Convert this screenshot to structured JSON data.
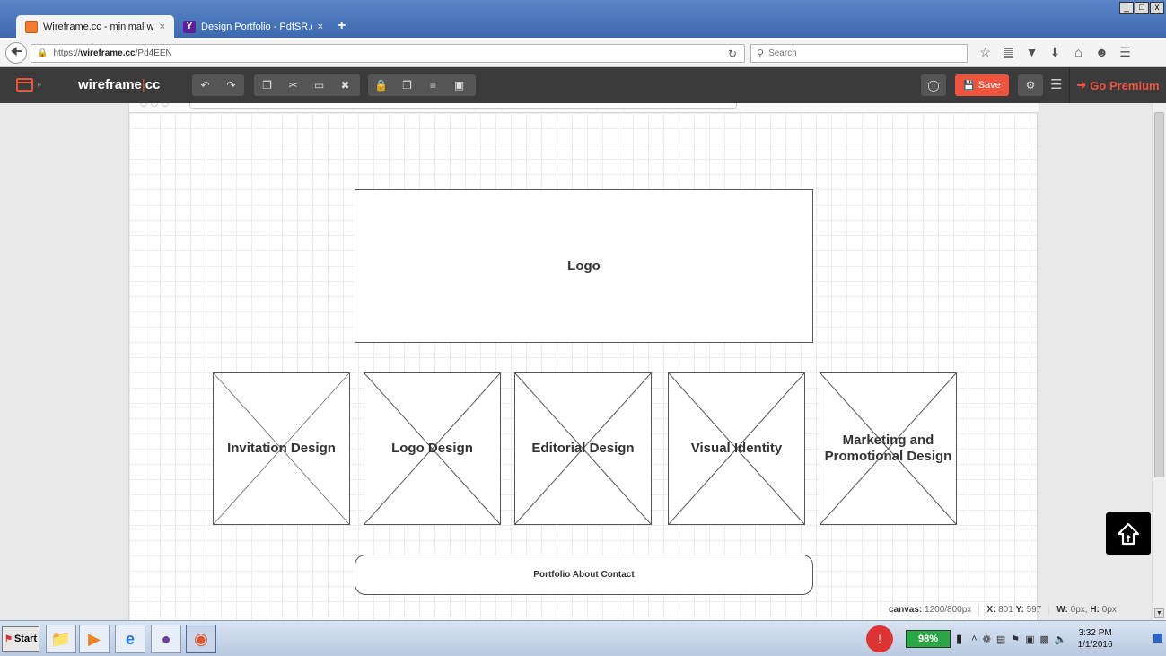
{
  "browser": {
    "tabs": [
      {
        "label": "Wireframe.cc - minimal wirefr...",
        "close": "×",
        "favicon": "wireframe-favicon"
      },
      {
        "label": "Design Portfolio - PdfSR.com",
        "close": "×",
        "favicon": "yahoo-favicon",
        "favicon_letter": "Y"
      }
    ],
    "new_tab": "+",
    "window_controls": [
      "_",
      "□",
      "x"
    ],
    "url_prefix": "https://",
    "url_host": "wireframe.cc",
    "url_path": "/Pd4EEN",
    "search_placeholder": "Search"
  },
  "app": {
    "name_part1": "wireframe",
    "name_sep": "|",
    "name_part2": "cc",
    "save_label": "Save",
    "premium_label": "Go Premium",
    "accent_color": "#f0533e"
  },
  "wireframe": {
    "logo_label": "Logo",
    "placeholders": [
      {
        "label": "Invitation Design"
      },
      {
        "label": "Logo Design"
      },
      {
        "label": "Editorial Design"
      },
      {
        "label": "Visual Identity"
      },
      {
        "label": "Marketing and Promotional Design"
      }
    ],
    "nav_label": "Portfolio About Contact"
  },
  "status": {
    "canvas_label": "canvas:",
    "canvas_value": "1200/800px",
    "x_label": "X:",
    "x_value": "801",
    "y_label": "Y:",
    "y_value": "597",
    "w_label": "W:",
    "w_value": "0px,",
    "h_label": "H:",
    "h_value": "0px"
  },
  "taskbar": {
    "start_label": "Start",
    "battery": "98%",
    "time": "3:32 PM",
    "date": "1/1/2016"
  }
}
